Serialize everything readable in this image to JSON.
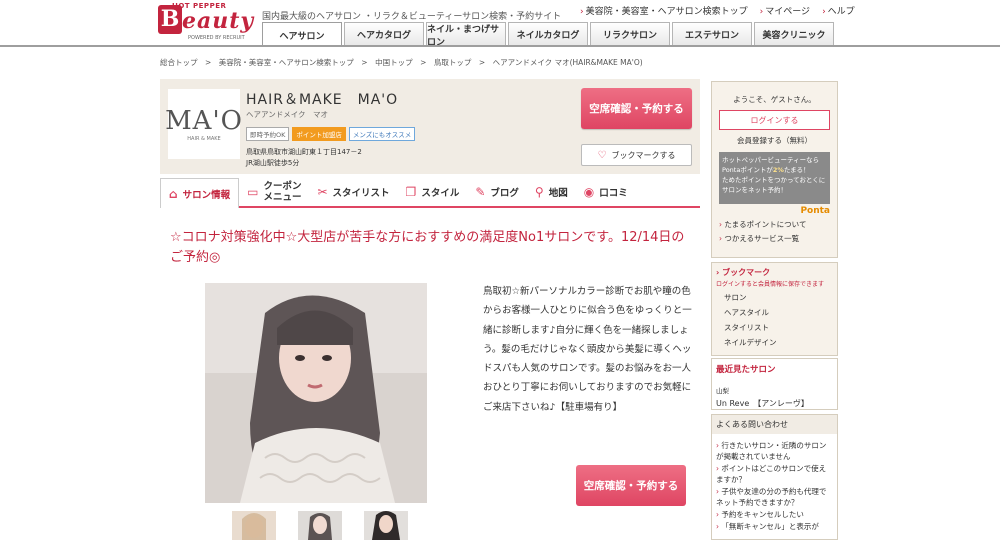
{
  "header": {
    "logo_top": "HOT PEPPER",
    "logo_b": "B",
    "logo_rest": "eauty",
    "logo_powered": "POWERED BY RECRUIT",
    "tagline": "国内最大級のヘアサロン ・リラク＆ビューティーサロン検索・予約サイト",
    "links": [
      "美容院・美容室・ヘアサロン検索トップ",
      "マイページ",
      "ヘルプ"
    ],
    "tabs": [
      "ヘアサロン",
      "ヘアカタログ",
      "ネイル・まつげサロン",
      "ネイルカタログ",
      "リラクサロン",
      "エステサロン",
      "美容クリニック"
    ]
  },
  "breadcrumb": "総合トップ　>　美容院・美容室・ヘアサロン検索トップ　>　中国トップ　>　鳥取トップ　>　ヘアアンドメイク マオ(HAIR&MAKE MA'O)",
  "salon": {
    "logo_text": "MA'O",
    "logo_sub": "HAIR & MAKE",
    "name": "HAIR＆MAKE　MA'O",
    "kana": "ヘアアンドメイク　マオ",
    "badges": [
      "即時予約OK",
      "ポイント加盟店",
      "メンズにもオススメ"
    ],
    "address_line1": "鳥取県鳥取市湖山町東１丁目147－2",
    "address_line2": "JR湖山駅徒歩5分",
    "reserve_label": "空席確認・予約する",
    "bookmark_label": "ブックマークする",
    "tabs": [
      {
        "icon": "home-icon",
        "glyph": "⌂",
        "label": "サロン情報"
      },
      {
        "icon": "coupon-icon",
        "glyph": "▭",
        "label": "クーポン\nメニュー"
      },
      {
        "icon": "scissors-icon",
        "glyph": "✂",
        "label": "スタイリスト"
      },
      {
        "icon": "book-icon",
        "glyph": "❐",
        "label": "スタイル"
      },
      {
        "icon": "pen-icon",
        "glyph": "✎",
        "label": "ブログ"
      },
      {
        "icon": "map-pin-icon",
        "glyph": "⚲",
        "label": "地図"
      },
      {
        "icon": "chat-icon",
        "glyph": "💬",
        "label": "口コミ"
      }
    ]
  },
  "main": {
    "catch": "☆コロナ対策強化中☆大型店が苦手な方におすすめの満足度No1サロンです。12/14日のご予約◎",
    "body": "鳥取初☆新パーソナルカラー診断でお肌や瞳の色からお客様一人ひとりに似合う色をゆっくりと一緒に診断します♪自分に輝く色を一緒探しましょう。髪の毛だけじゃなく頭皮から美髪に導くヘッドスパも人気のサロンです。髪のお悩みをお一人おひとり丁寧にお伺いしておりますのでお気軽にご来店下さいね♪【駐車場有り】",
    "reserve_label": "空席確認・予約する"
  },
  "sidebar": {
    "welcome": "ようこそ、ゲストさん。",
    "login": "ログインする",
    "register": "会員登録する（無料）",
    "ponta_text1": "ホットペッパービューティーなら",
    "ponta_text2": "Pontaポイントが",
    "ponta_pct": "2%",
    "ponta_text3": "たまる！",
    "ponta_text4": "ためたポイントをつかっておとくにサロンをネット予約！",
    "ponta_logo": "Ponta",
    "links": [
      "たまるポイントについて",
      "つかえるサービス一覧"
    ],
    "bookmark_title": "ブックマーク",
    "bookmark_note": "ログインすると会員情報に保存できます",
    "bookmark_items": [
      "サロン",
      "ヘアスタイル",
      "スタイリスト",
      "ネイルデザイン"
    ],
    "recent_title": "最近見たサロン",
    "recent_area": "山梨",
    "recent_salon": "Un Reve　【アンレーヴ】",
    "faq_title": "よくある問い合わせ",
    "faq": [
      "行きたいサロン・近隣のサロンが掲載されていません",
      "ポイントはどこのサロンで使えますか？",
      "子供や友達の分の予約も代理でネット予約できますか？",
      "予約をキャンセルしたい",
      "「無断キャンセル」と表示が"
    ]
  },
  "colors": {
    "brand": "#c3243e",
    "accent": "#df4563",
    "panel": "#f1ece4"
  }
}
